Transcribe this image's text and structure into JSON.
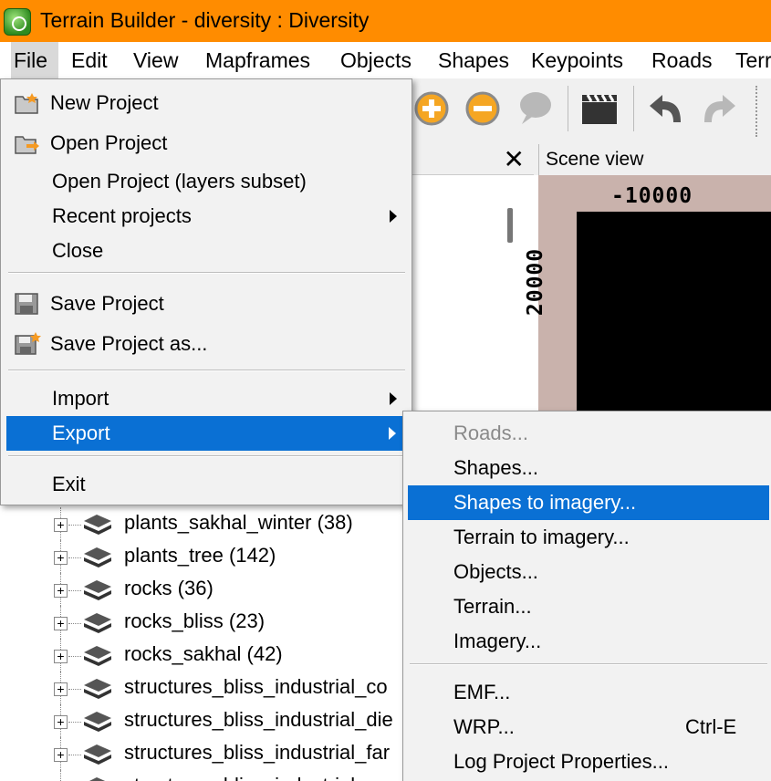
{
  "window": {
    "title": "Terrain Builder - diversity : Diversity",
    "app_icon": "terrain-builder-app-icon"
  },
  "menubar": {
    "items": [
      "File",
      "Edit",
      "View",
      "Mapframes",
      "Objects",
      "Shapes",
      "Keypoints",
      "Roads",
      "Terr"
    ]
  },
  "toolbar": {
    "icons": [
      "zoom-in-icon",
      "zoom-out-icon",
      "comment-icon",
      "clapperboard-icon",
      "undo-icon",
      "redo-icon"
    ]
  },
  "panel": {
    "close": "✕"
  },
  "scene": {
    "title": "Scene view",
    "ruler_x": "-10000",
    "ruler_y": "20000"
  },
  "file_menu": {
    "items": [
      {
        "label": "New Project",
        "icon": "new-project-icon"
      },
      {
        "label": "Open Project",
        "icon": "open-project-icon"
      },
      {
        "label": "Open Project (layers subset)"
      },
      {
        "label": "Recent projects",
        "submenu": true
      },
      {
        "label": "Close"
      },
      {
        "label": "Save Project",
        "icon": "save-icon"
      },
      {
        "label": "Save Project as...",
        "icon": "save-as-icon"
      },
      {
        "label": "Import",
        "submenu": true
      },
      {
        "label": "Export",
        "submenu": true,
        "highlighted": true
      },
      {
        "label": "Exit"
      }
    ]
  },
  "export_menu": {
    "items": [
      {
        "label": "Roads...",
        "disabled": true
      },
      {
        "label": "Shapes..."
      },
      {
        "label": "Shapes to imagery...",
        "highlighted": true
      },
      {
        "label": "Terrain to imagery..."
      },
      {
        "label": "Objects..."
      },
      {
        "label": "Terrain..."
      },
      {
        "label": "Imagery..."
      },
      {
        "label": "EMF..."
      },
      {
        "label": "WRP...",
        "shortcut": "Ctrl-E"
      },
      {
        "label": "Log Project Properties..."
      }
    ]
  },
  "tree": {
    "rows": [
      "plants_sakhal_winter (38)",
      "plants_tree (142)",
      "rocks (36)",
      "rocks_bliss (23)",
      "rocks_sakhal (42)",
      "structures_bliss_industrial_co",
      "structures_bliss_industrial_die",
      "structures_bliss_industrial_far",
      "structures_bliss_industrial"
    ]
  },
  "colors": {
    "titlebar": "#ff8c00",
    "highlight": "#0a70d4"
  }
}
